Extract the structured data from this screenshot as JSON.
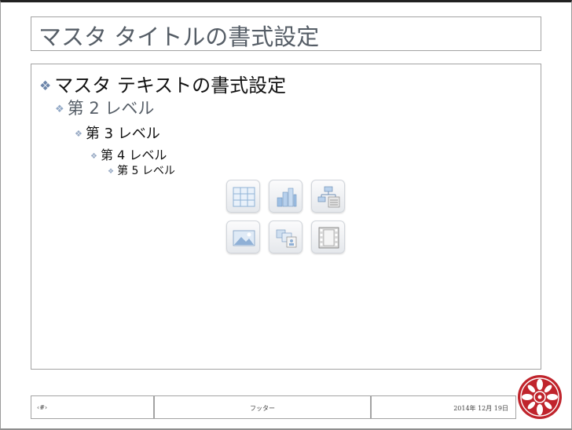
{
  "title": {
    "text": "マスタ タイトルの書式設定"
  },
  "body": {
    "levels": [
      {
        "label": "マスタ テキストの書式設定"
      },
      {
        "label": "第 2 レベル"
      },
      {
        "label": "第 3 レベル"
      },
      {
        "label": "第 4 レベル"
      },
      {
        "label": "第 5 レベル"
      }
    ],
    "bullet": "❖"
  },
  "insert_icons": [
    "table-icon",
    "chart-icon",
    "smartart-icon",
    "picture-icon",
    "clipart-icon",
    "media-icon"
  ],
  "footer": {
    "slide_number": "‹#›",
    "center": "フッター",
    "date": "2014年 12月 19日"
  },
  "colors": {
    "bullet": "#6d86aa",
    "title_text": "#555d66",
    "logo": "#c0242c"
  }
}
